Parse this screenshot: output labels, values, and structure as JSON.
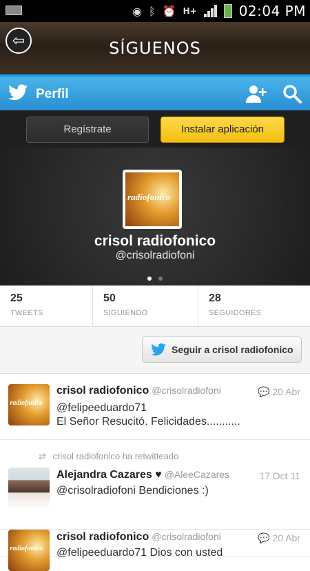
{
  "status_bar": {
    "time": "02:04 PM",
    "network": "H+"
  },
  "header": {
    "title": "SÍGUENOS"
  },
  "twitter_bar": {
    "title": "Perfil"
  },
  "actions": {
    "register_label": "Regístrate",
    "install_label": "Instalar aplicación"
  },
  "profile": {
    "name": "crisol radiofonico",
    "handle": "@crisolradiofoni",
    "avatar_text": "radiofonico"
  },
  "stats": [
    {
      "value": "25",
      "label": "TWEETS"
    },
    {
      "value": "50",
      "label": "SIGUIENDO"
    },
    {
      "value": "28",
      "label": "SEGUIDORES"
    }
  ],
  "follow": {
    "label": "Seguir a crisol radiofonico"
  },
  "tweets": [
    {
      "name": "crisol radiofonico",
      "handle": "@crisolradiofoni",
      "time": "20 Abr",
      "line1": "@felipeeduardo71",
      "line2": "El Señor Resucitó. Felicidades..........."
    },
    {
      "retweet_note": "crisol radiofonico ha retwitteado",
      "name": "Alejandra Cazares ♥",
      "handle": "@AleeCazares",
      "time": "17 Oct 11",
      "line1": "@crisolradiofoni Bendiciones :)"
    },
    {
      "name": "crisol radiofonico",
      "handle": "@crisolradiofoni",
      "time": "20 Abr",
      "line1": "@felipeeduardo71 Dios con usted"
    }
  ],
  "colors": {
    "twitter_blue": "#2a8fd3",
    "install_yellow": "#f2bf10",
    "banner_dark": "#262626"
  }
}
